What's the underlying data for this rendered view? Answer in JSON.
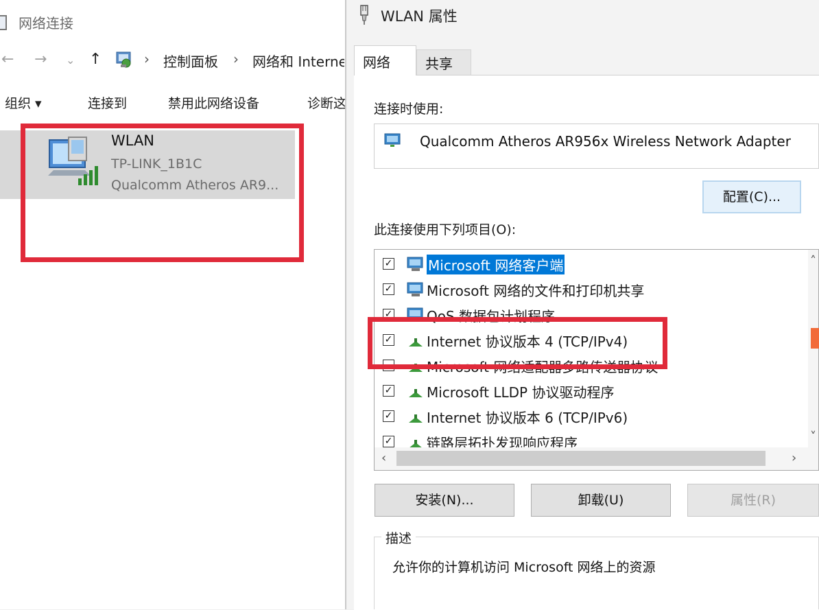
{
  "explorer": {
    "title": "网络连接",
    "nav": {
      "back": "←",
      "forward": "→",
      "history": "⌄",
      "up": "↑"
    },
    "breadcrumb": [
      "控制面板",
      "网络和 Interne"
    ],
    "breadcrumb_sep": "›",
    "toolbar": {
      "organize": "组织 ▾",
      "connect_to": "连接到",
      "disable": "禁用此网络设备",
      "diagnose": "诊断这"
    },
    "connection": {
      "name": "WLAN",
      "ssid": "TP-LINK_1B1C",
      "adapter": "Qualcomm Atheros AR9..."
    },
    "highlight_color": "#e02a3a"
  },
  "dialog": {
    "title": "WLAN 属性",
    "tabs": [
      {
        "label": "网络",
        "active": true
      },
      {
        "label": "共享",
        "active": false
      }
    ],
    "connect_using_label": "连接时使用:",
    "adapter_name": "Qualcomm Atheros AR956x Wireless Network Adapter",
    "configure_button": "配置(C)...",
    "items_label": "此连接使用下列项目(O):",
    "items": [
      {
        "text": "Microsoft 网络客户端",
        "checked": true,
        "selected": true,
        "icon": "network-client-icon"
      },
      {
        "text": "Microsoft 网络的文件和打印机共享",
        "checked": true,
        "selected": false,
        "icon": "network-service-icon"
      },
      {
        "text": "QoS 数据包计划程序",
        "checked": true,
        "selected": false,
        "icon": "network-service-icon"
      },
      {
        "text": "Internet 协议版本 4 (TCP/IPv4)",
        "checked": true,
        "selected": false,
        "icon": "protocol-icon"
      },
      {
        "text": "Microsoft 网络适配器多路传送器协议",
        "checked": false,
        "selected": false,
        "icon": "protocol-icon"
      },
      {
        "text": "Microsoft LLDP 协议驱动程序",
        "checked": true,
        "selected": false,
        "icon": "protocol-icon"
      },
      {
        "text": "Internet 协议版本 6 (TCP/IPv6)",
        "checked": true,
        "selected": false,
        "icon": "protocol-icon"
      },
      {
        "text": "链路层拓扑发现响应程序",
        "checked": true,
        "selected": false,
        "icon": "protocol-icon"
      }
    ],
    "install_button": "安装(N)...",
    "uninstall_button": "卸载(U)",
    "properties_button": "属性(R)",
    "description_label": "描述",
    "description_text": "允许你的计算机访问 Microsoft 网络上的资源",
    "selection_color": "#0078d7"
  }
}
